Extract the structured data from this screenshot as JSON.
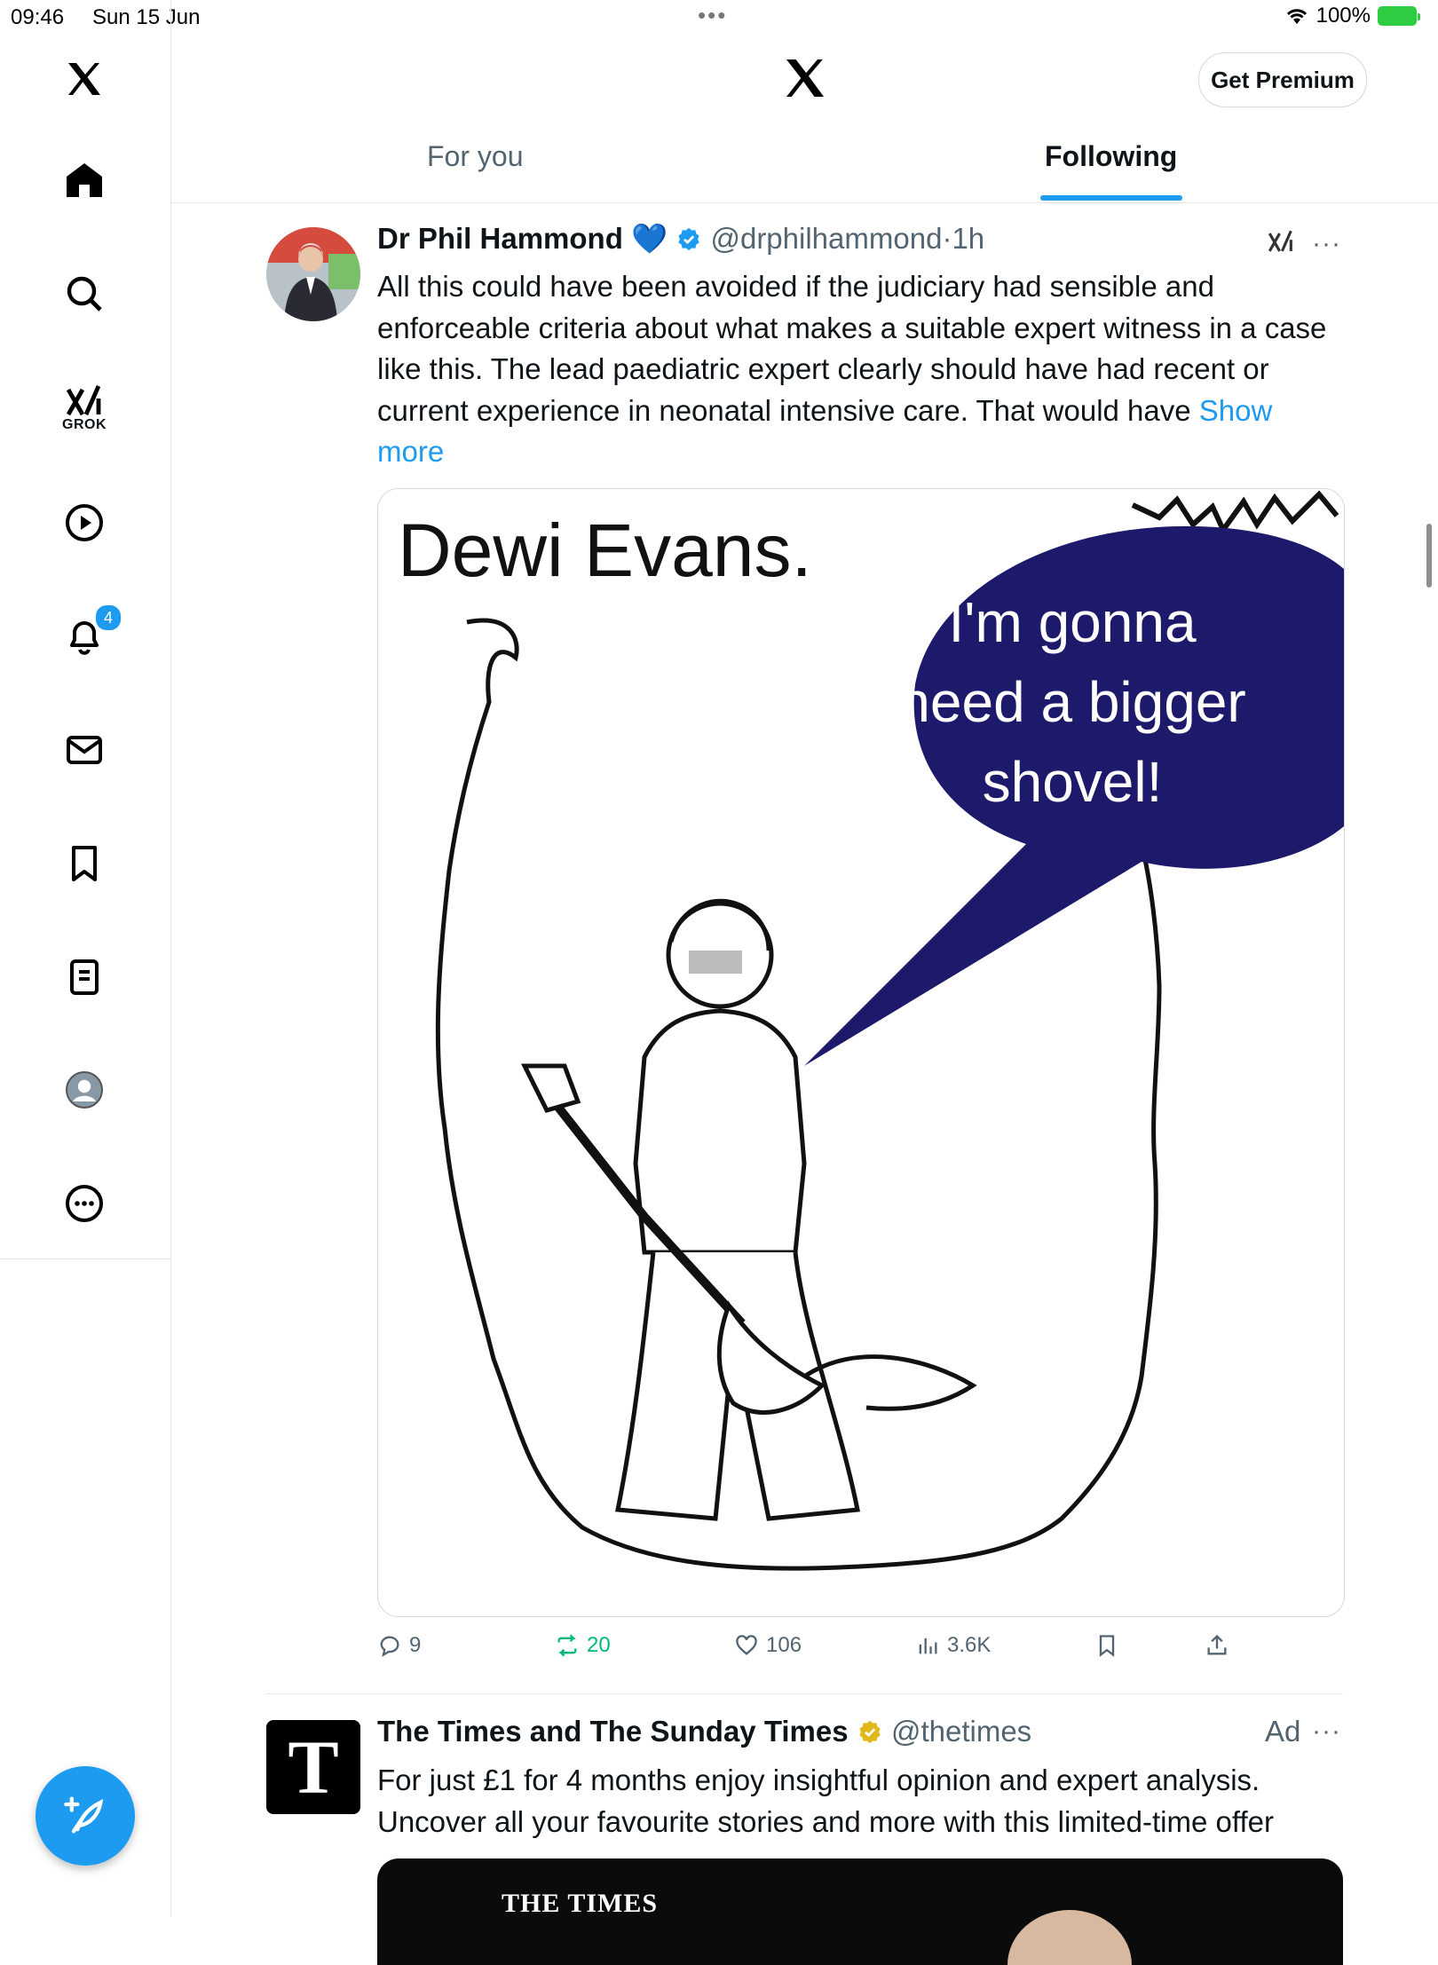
{
  "status_bar": {
    "time": "09:46",
    "date": "Sun 15 Jun",
    "battery": "100%"
  },
  "sidebar": {
    "items": [
      {
        "name": "x-logo-icon"
      },
      {
        "name": "home-icon"
      },
      {
        "name": "search-icon"
      },
      {
        "name": "grok-icon",
        "label": "GROK"
      },
      {
        "name": "play-icon"
      },
      {
        "name": "bell-icon",
        "badge": "4"
      },
      {
        "name": "mail-icon"
      },
      {
        "name": "bookmark-icon"
      },
      {
        "name": "list-icon"
      },
      {
        "name": "profile-icon"
      },
      {
        "name": "more-circle-icon"
      }
    ],
    "compose_icon": "feather-plus-icon"
  },
  "header": {
    "premium_label": "Get Premium",
    "tabs": [
      {
        "label": "For you",
        "active": false
      },
      {
        "label": "Following",
        "active": true
      }
    ],
    "accent": "#1d9bf0"
  },
  "tweet": {
    "name": "Dr Phil Hammond",
    "emoji": "💙",
    "handle": "@drphilhammond",
    "dot": "·",
    "time": "1h",
    "text": "All this could have been avoided if the judiciary had sensible and enforceable criteria about what makes a suitable expert witness in a case like this. The lead paediatric expert clearly should have had recent or current experience in neonatal intensive care. That would have",
    "show_more": "Show more",
    "image": {
      "caption_title": "Dewi Evans.",
      "speech_lines": [
        "I'm gonna",
        "need a bigger",
        "shovel!"
      ],
      "bubble_color": "#1e1a6b"
    },
    "actions": {
      "replies": "9",
      "reposts": "20",
      "likes": "106",
      "views": "3.6K"
    },
    "repost_color": "#00ba7c"
  },
  "ad_tweet": {
    "avatar_letter": "T",
    "name": "The Times and The Sunday Times",
    "handle": "@thetimes",
    "ad_label": "Ad",
    "text": "For just £1 for 4 months enjoy insightful opinion and expert analysis. Uncover all your favourite stories and more with this limited-time offer",
    "banner_brand": "THE TIMES"
  }
}
